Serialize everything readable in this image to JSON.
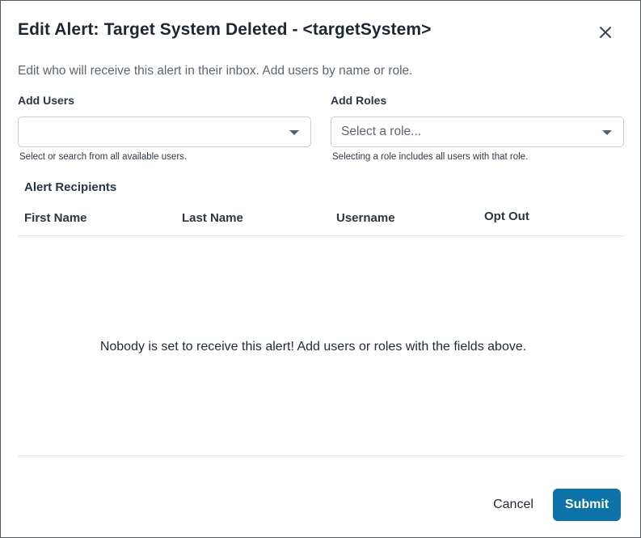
{
  "dialog": {
    "title": "Edit Alert: Target System Deleted - <targetSystem>",
    "subtitle": "Edit who will receive this alert in their inbox. Add users by name or role.",
    "close_icon": "close-icon"
  },
  "add_users": {
    "label": "Add Users",
    "value": "",
    "placeholder": "",
    "help": "Select or search from all available users."
  },
  "add_roles": {
    "label": "Add Roles",
    "placeholder": "Select a role...",
    "help": "Selecting a role includes all users with that role."
  },
  "recipients": {
    "title": "Alert Recipients",
    "columns": [
      "First Name",
      "Last Name",
      "Username",
      "Opt Out"
    ],
    "rows": [],
    "empty_message": "Nobody is set to receive this alert! Add users or roles with the fields above."
  },
  "footer": {
    "cancel_label": "Cancel",
    "submit_label": "Submit"
  },
  "colors": {
    "primary": "#0c72a8",
    "border": "#c9ced4",
    "text": "#1f2a37",
    "muted": "#5c6570"
  }
}
